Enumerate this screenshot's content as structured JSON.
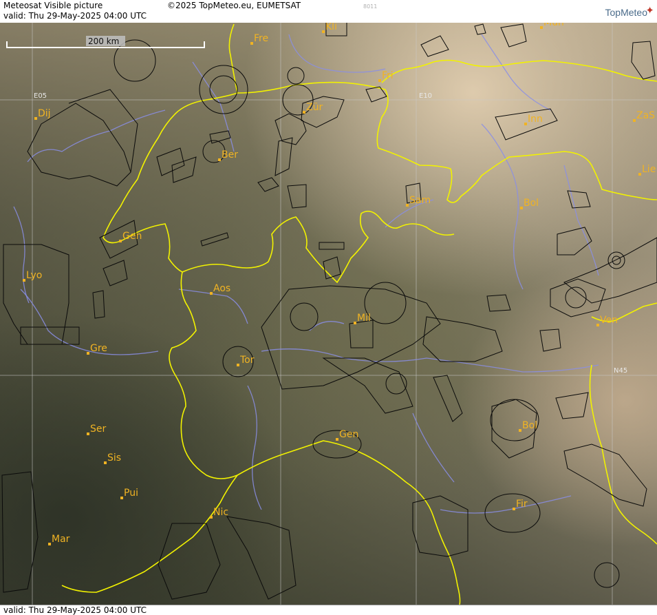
{
  "header": {
    "title": "Meteosat Visible picture",
    "credit": "©2025 TopMeteo.eu, EUMETSAT",
    "code": "8011",
    "valid_text": "valid:  Thu  29-May-2025  04:00 UTC",
    "logo_text": "TopMeteo"
  },
  "footer": {
    "valid_text": "valid:  Thu  29-May-2025  04:00 UTC"
  },
  "map": {
    "scale_label": "200 km",
    "grid_labels": {
      "lon_e05": "E05",
      "lon_e10": "E10",
      "lat_n45": "N45"
    },
    "cities": [
      {
        "label": "Kli"
      },
      {
        "label": "Mun"
      },
      {
        "label": "Fre"
      },
      {
        "label": "Fri"
      },
      {
        "label": "Dij"
      },
      {
        "label": "Zür"
      },
      {
        "label": "Inn"
      },
      {
        "label": "ZaS"
      },
      {
        "label": "Ber"
      },
      {
        "label": "Lie"
      },
      {
        "label": "Sam"
      },
      {
        "label": "Bol"
      },
      {
        "label": "Gen"
      },
      {
        "label": "Lyo"
      },
      {
        "label": "Aos"
      },
      {
        "label": "Mil"
      },
      {
        "label": "Ven"
      },
      {
        "label": "Gre"
      },
      {
        "label": "Tor"
      },
      {
        "label": "Ser"
      },
      {
        "label": "Gen"
      },
      {
        "label": "Bol"
      },
      {
        "label": "Sis"
      },
      {
        "label": "Pui"
      },
      {
        "label": "Nic"
      },
      {
        "label": "Fir"
      },
      {
        "label": "Mar"
      }
    ],
    "colors": {
      "border": "#f2f200",
      "river": "#8a8ee6",
      "airspace": "#0a0a0a",
      "grid": "#c8c8c8",
      "label": "#f0b323"
    }
  }
}
